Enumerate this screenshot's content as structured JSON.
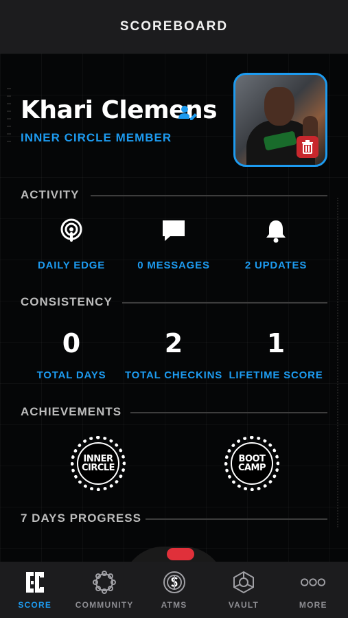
{
  "header": {
    "title": "SCOREBOARD"
  },
  "profile": {
    "name": "Khari Clemens",
    "membership": "INNER CIRCLE MEMBER",
    "edit_icon": "person-edit-icon",
    "delete_icon": "trash-icon"
  },
  "activity": {
    "label": "ACTIVITY",
    "items": [
      {
        "icon": "podcast-icon",
        "label": "DAILY EDGE"
      },
      {
        "icon": "message-icon",
        "label": "0 MESSAGES"
      },
      {
        "icon": "bell-icon",
        "label": "2 UPDATES"
      }
    ]
  },
  "consistency": {
    "label": "CONSISTENCY",
    "stats": [
      {
        "value": "0",
        "label": "TOTAL DAYS"
      },
      {
        "value": "2",
        "label": "TOTAL CHECKINS"
      },
      {
        "value": "1",
        "label": "LIFETIME SCORE"
      }
    ]
  },
  "achievements": {
    "label": "ACHIEVEMENTS",
    "badges": [
      {
        "line1": "INNER",
        "line2": "CIRCLE"
      },
      {
        "line1": "BOOT",
        "line2": "CAMP"
      }
    ]
  },
  "progress": {
    "label": "7 DAYS PROGRESS"
  },
  "tabbar": {
    "tabs": [
      {
        "label": "SCORE",
        "icon": "gc-logo-icon",
        "active": true
      },
      {
        "label": "COMMUNITY",
        "icon": "community-icon",
        "active": false
      },
      {
        "label": "ATMS",
        "icon": "atms-icon",
        "active": false
      },
      {
        "label": "VAULT",
        "icon": "vault-icon",
        "active": false
      },
      {
        "label": "MORE",
        "icon": "more-icon",
        "active": false
      }
    ]
  },
  "colors": {
    "accent": "#1d9bf0",
    "danger": "#c8272d",
    "background": "#000000"
  }
}
